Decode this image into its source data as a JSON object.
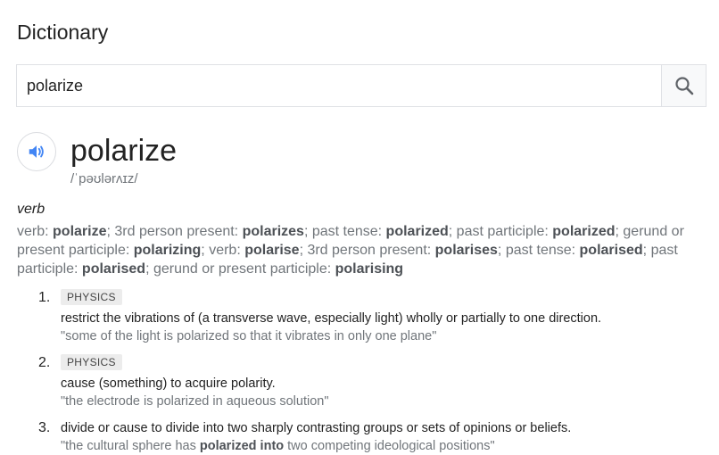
{
  "header": {
    "title": "Dictionary"
  },
  "search": {
    "value": "polarize",
    "button_icon": "search-icon"
  },
  "entry": {
    "word": "polarize",
    "phonetic": "/ˈpəʊlərʌɪz/",
    "part_of_speech": "verb",
    "forms": [
      {
        "text": "verb: ",
        "bold": false
      },
      {
        "text": "polarize",
        "bold": true
      },
      {
        "text": "; 3rd person present: ",
        "bold": false
      },
      {
        "text": "polarizes",
        "bold": true
      },
      {
        "text": "; past tense: ",
        "bold": false
      },
      {
        "text": "polarized",
        "bold": true
      },
      {
        "text": "; past participle: ",
        "bold": false
      },
      {
        "text": "polarized",
        "bold": true
      },
      {
        "text": "; gerund or present participle: ",
        "bold": false
      },
      {
        "text": "polarizing",
        "bold": true
      },
      {
        "text": "; verb: ",
        "bold": false
      },
      {
        "text": "polarise",
        "bold": true
      },
      {
        "text": "; 3rd person present: ",
        "bold": false
      },
      {
        "text": "polarises",
        "bold": true
      },
      {
        "text": "; past tense: ",
        "bold": false
      },
      {
        "text": "polarised",
        "bold": true
      },
      {
        "text": "; past participle: ",
        "bold": false
      },
      {
        "text": "polarised",
        "bold": true
      },
      {
        "text": "; gerund or present participle: ",
        "bold": false
      },
      {
        "text": "polarising",
        "bold": true
      }
    ],
    "definitions": [
      {
        "number": "1.",
        "tag": "PHYSICS",
        "text": "restrict the vibrations of (a transverse wave, especially light) wholly or partially to one direction.",
        "example": "\"some of the light is polarized so that it vibrates in only one plane\""
      },
      {
        "number": "2.",
        "tag": "PHYSICS",
        "text": "cause (something) to acquire polarity.",
        "example": "\"the electrode is polarized in aqueous solution\""
      },
      {
        "number": "3.",
        "text": "divide or cause to divide into two sharply contrasting groups or sets of opinions or beliefs.",
        "example_parts": [
          {
            "text": "\"the cultural sphere has ",
            "bold": false
          },
          {
            "text": "polarized into",
            "bold": true
          },
          {
            "text": " two competing ideological positions\"",
            "bold": false
          }
        ]
      }
    ]
  },
  "colors": {
    "accent": "#4285f4",
    "muted": "#70757a",
    "border": "#dfe1e5"
  }
}
